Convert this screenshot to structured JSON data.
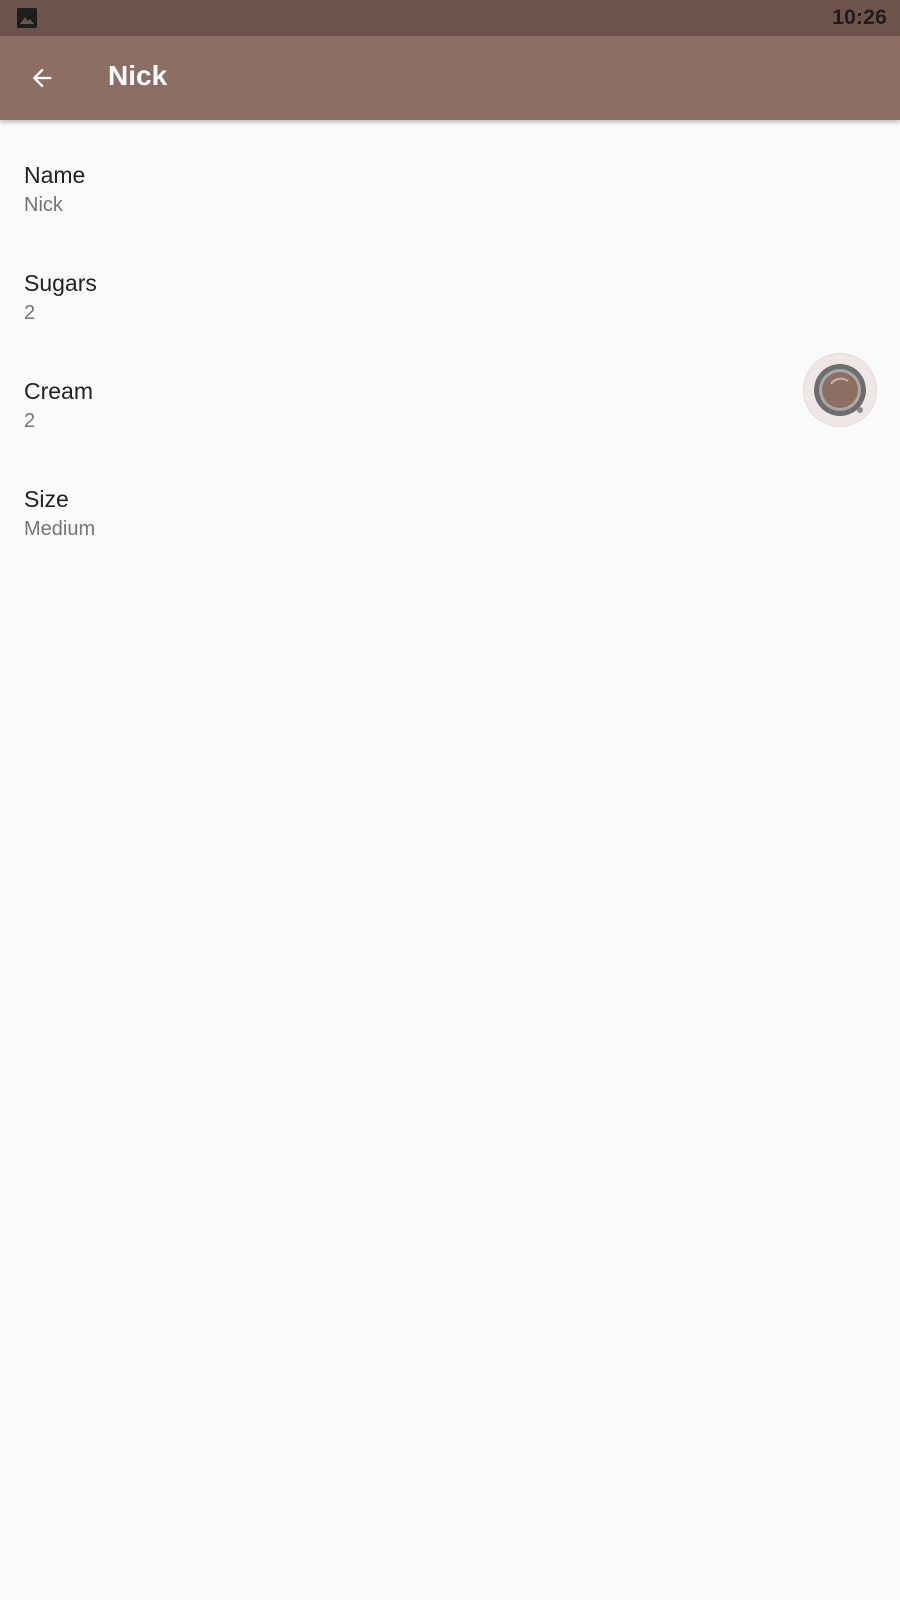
{
  "status_bar": {
    "time": "10:26",
    "notification_icon": "image-icon"
  },
  "app_bar": {
    "back_icon": "arrow-back-icon",
    "title": "Nick",
    "color": "#8d6e63"
  },
  "details": [
    {
      "label": "Name",
      "value": "Nick"
    },
    {
      "label": "Sugars",
      "value": "2"
    },
    {
      "label": "Cream",
      "value": "2"
    },
    {
      "label": "Size",
      "value": "Medium"
    }
  ],
  "avatar_icon": "coffee-cup-icon",
  "colors": {
    "status_bar": "#6d534c",
    "background": "#fafafa",
    "label_text": "#212121",
    "value_text": "#757575"
  }
}
